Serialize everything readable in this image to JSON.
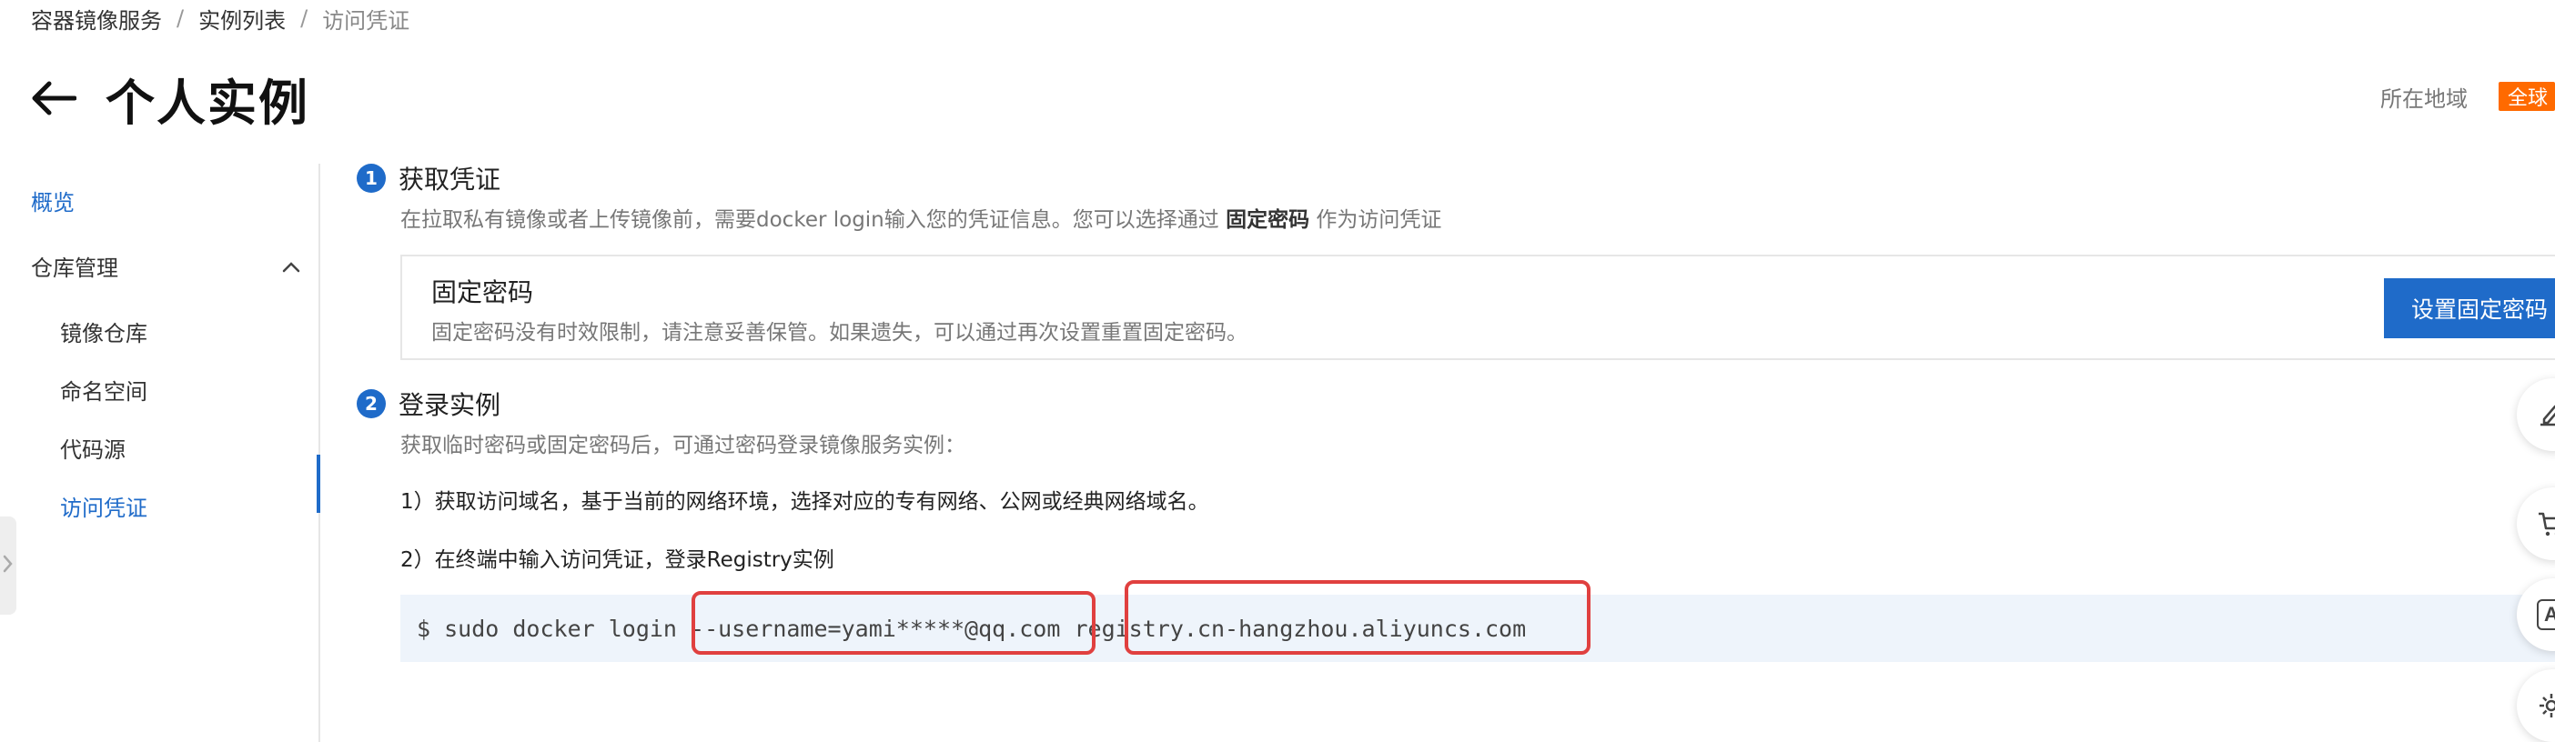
{
  "breadcrumb": {
    "items": [
      "容器镜像服务",
      "实例列表",
      "访问凭证"
    ],
    "separator": "/"
  },
  "header": {
    "title": "个人实例",
    "back_icon": "arrow-left-icon",
    "region_label": "所在地域",
    "region_value": "全球"
  },
  "sidebar": {
    "overview": "概览",
    "repo_management": "仓库管理",
    "image_repos": "镜像仓库",
    "namespaces": "命名空间",
    "code_sources": "代码源",
    "access_credentials": "访问凭证",
    "active_item": "访问凭证"
  },
  "step1": {
    "number": "1",
    "title": "获取凭证",
    "desc_prefix": "在拉取私有镜像或者上传镜像前，需要docker login输入您的凭证信息。您可以选择通过 ",
    "desc_bold": "固定密码",
    "desc_suffix": " 作为访问凭证",
    "card": {
      "title": "固定密码",
      "desc": "固定密码没有时效限制，请注意妥善保管。如果遗失，可以通过再次设置重置固定密码。",
      "button": "设置固定密码"
    }
  },
  "step2": {
    "number": "2",
    "title": "登录实例",
    "desc": "获取临时密码或固定密码后，可通过密码登录镜像服务实例：",
    "line1": "1）获取访问域名，基于当前的网络环境，选择对应的专有网络、公网或经典网络域名。",
    "line2": "2）在终端中输入访问凭证，登录Registry实例",
    "command": "$ sudo docker login --username=yami*****@qq.com registry.cn-hangzhou.aliyuncs.com"
  },
  "float_toolbar": {
    "icons": [
      "edit-icon",
      "cart-icon",
      "api-icon",
      "settings-icon"
    ],
    "api_text": "API"
  },
  "colors": {
    "accent": "#1f6bc9",
    "region_badge": "#ff6a00",
    "highlight_box": "#e0403f",
    "code_bg": "#eef4fb"
  }
}
